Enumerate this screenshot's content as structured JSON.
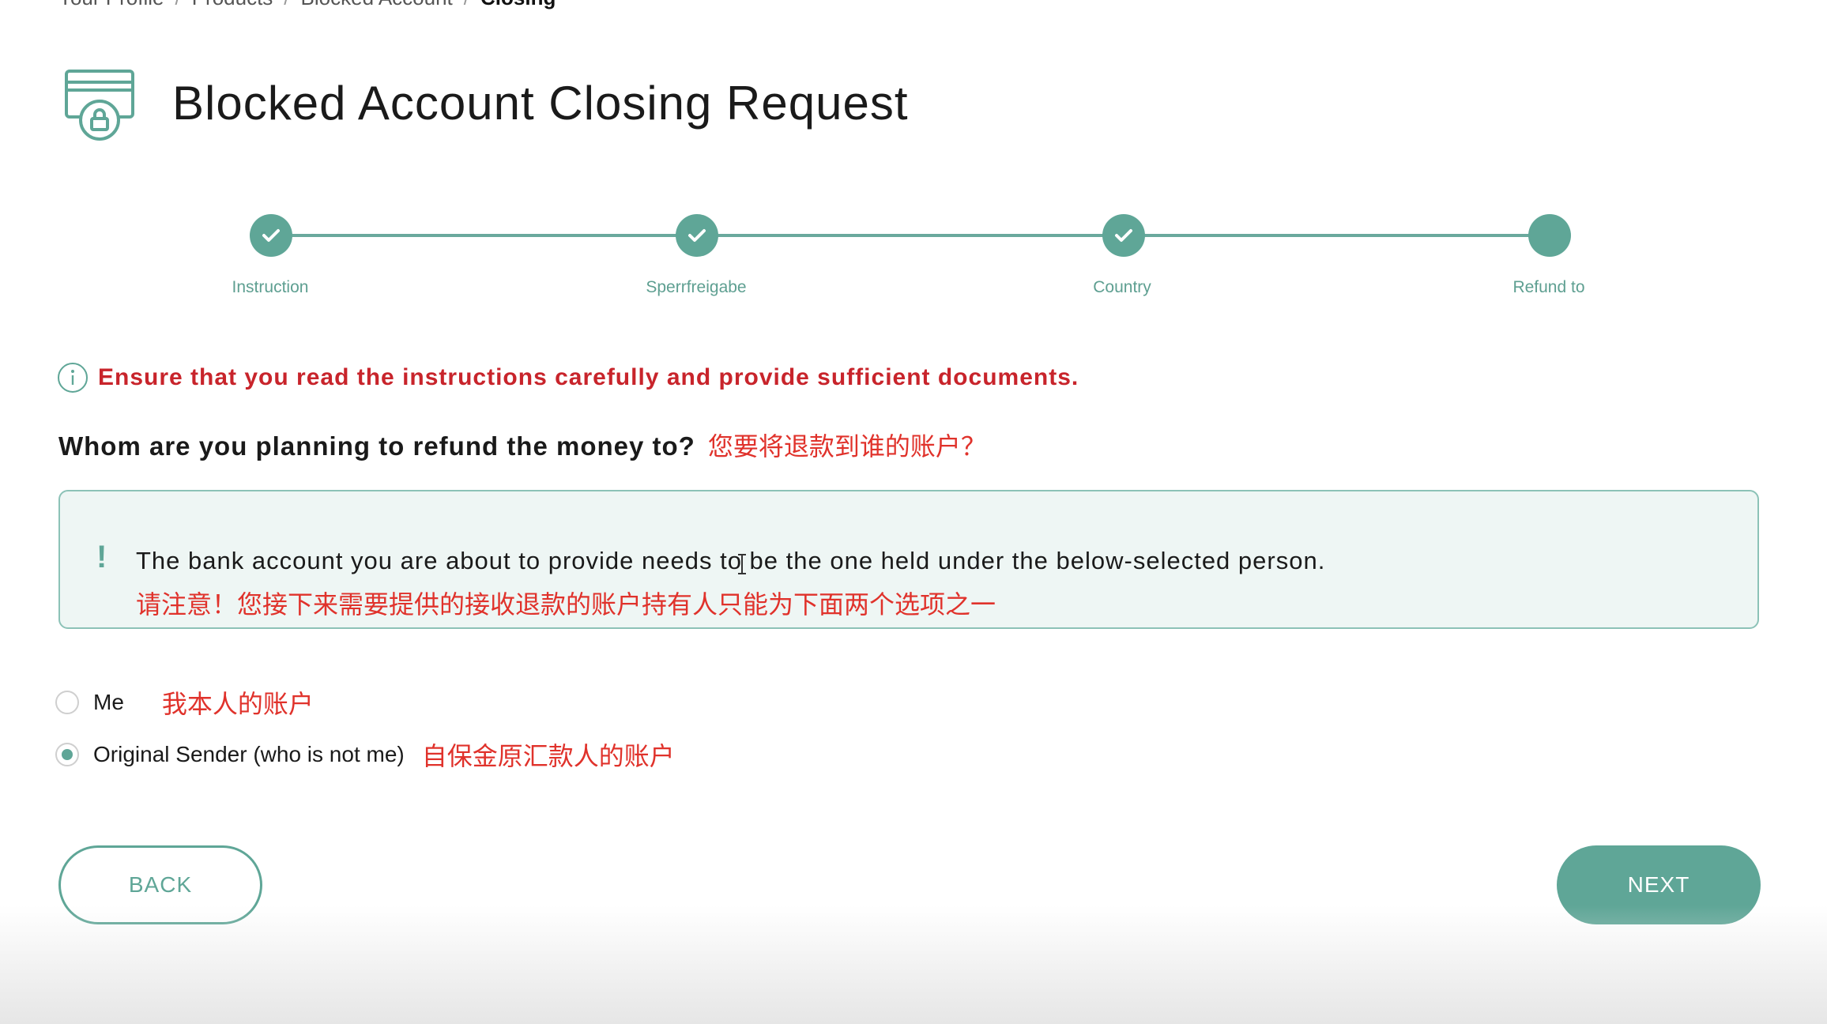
{
  "breadcrumb": {
    "items": [
      "Your Profile",
      "Products",
      "Blocked Account"
    ],
    "current": "Closing"
  },
  "header": {
    "title": "Blocked Account Closing Request",
    "icon": "locked-card-icon"
  },
  "stepper": {
    "steps": [
      {
        "label": "Instruction",
        "status": "completed"
      },
      {
        "label": "Sperrfreigabe",
        "status": "completed"
      },
      {
        "label": "Country",
        "status": "completed"
      },
      {
        "label": "Refund to",
        "status": "current"
      }
    ]
  },
  "info": {
    "text": "Ensure that you read the instructions carefully and provide sufficient documents."
  },
  "question": {
    "text": "Whom are you planning to refund the money to?",
    "cn_note": "您要将退款到谁的账户？"
  },
  "notice": {
    "text": "The bank account you are about to provide needs to be the one held under the below-selected person.",
    "cn_note": "请注意！您接下来需要提供的接收退款的账户持有人只能为下面两个选项之一"
  },
  "options": [
    {
      "label": "Me",
      "cn_note": "我本人的账户",
      "selected": false
    },
    {
      "label": "Original Sender (who is not me)",
      "cn_note": "自保金原汇款人的账户",
      "selected": true
    }
  ],
  "buttons": {
    "back": "BACK",
    "next": "NEXT"
  },
  "colors": {
    "accent": "#5fa697",
    "warning_text": "#c8242b",
    "annotation_text": "#e0322b",
    "notice_bg": "#eef6f4"
  }
}
